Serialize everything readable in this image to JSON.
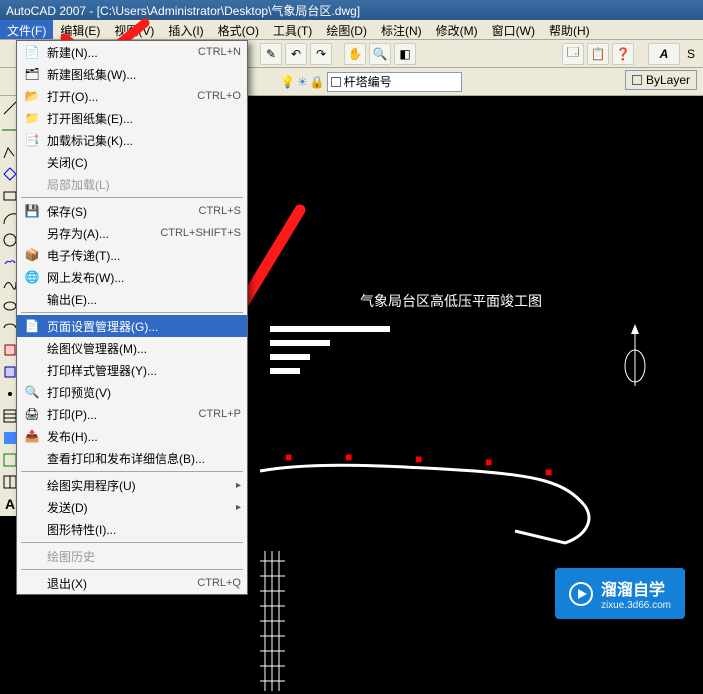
{
  "title": "AutoCAD 2007 - [C:\\Users\\Administrator\\Desktop\\气象局台区.dwg]",
  "menu": {
    "file": "文件(F)",
    "edit": "编辑(E)",
    "view": "视图(V)",
    "insert": "插入(I)",
    "format": "格式(O)",
    "tools": "工具(T)",
    "draw": "绘图(D)",
    "dimension": "标注(N)",
    "modify": "修改(M)",
    "window": "窗口(W)",
    "help": "帮助(H)"
  },
  "layer": {
    "name": "杆塔编号"
  },
  "bylayer": "ByLayer",
  "fileMenu": {
    "new": "新建(N)...",
    "newShortcut": "CTRL+N",
    "newSheet": "新建图纸集(W)...",
    "open": "打开(O)...",
    "openShortcut": "CTRL+O",
    "openSheet": "打开图纸集(E)...",
    "loadMarkup": "加载标记集(K)...",
    "close": "关闭(C)",
    "partialLoad": "局部加载(L)",
    "save": "保存(S)",
    "saveShortcut": "CTRL+S",
    "saveAs": "另存为(A)...",
    "saveAsShortcut": "CTRL+SHIFT+S",
    "etransmit": "电子传递(T)...",
    "webPublish": "网上发布(W)...",
    "export": "输出(E)...",
    "pageSetup": "页面设置管理器(G)...",
    "plotterMgr": "绘图仪管理器(M)...",
    "plotStyleMgr": "打印样式管理器(Y)...",
    "plotPreview": "打印预览(V)",
    "plot": "打印(P)...",
    "plotShortcut": "CTRL+P",
    "publish": "发布(H)...",
    "plotDetails": "查看打印和发布详细信息(B)...",
    "utilities": "绘图实用程序(U)",
    "send": "发送(D)",
    "properties": "图形特性(I)...",
    "history": "绘图历史",
    "exit": "退出(X)",
    "exitShortcut": "CTRL+Q"
  },
  "drawing": {
    "title": "气象局台区高低压平面竣工图"
  },
  "watermark": {
    "brand": "溜溜自学",
    "url": "zixue.3d66.com"
  }
}
